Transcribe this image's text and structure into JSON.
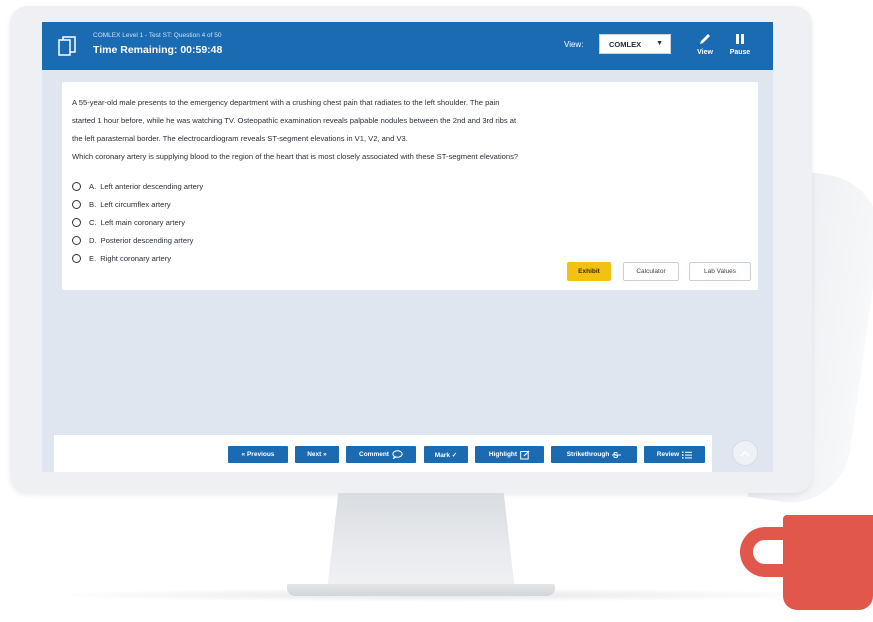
{
  "header": {
    "subtitle": "COMLEX Level 1 - Test ST: Question 4 of 50",
    "timer": "Time Remaining: 00:59:48",
    "view_label": "View:",
    "exam_select_value": "COMLEX",
    "view_button_label": "View",
    "pause_button_label": "Pause"
  },
  "question": {
    "stem": [
      "A 55-year-old male presents to the emergency department with a crushing chest pain that radiates to the left shoulder. The pain",
      "started 1 hour before, while he was watching TV. Osteopathic examination reveals palpable nodules between the 2nd and 3rd ribs at",
      "the left parasternal border. The electrocardiogram reveals ST-segment elevations in V1, V2, and V3."
    ],
    "prompt": "Which coronary artery is supplying blood to the region of the heart that is most closely associated with these ST-segment elevations?",
    "choices": [
      {
        "letter": "A.",
        "text": "Left anterior descending artery"
      },
      {
        "letter": "B.",
        "text": "Left circumflex artery"
      },
      {
        "letter": "C.",
        "text": "Left main coronary artery"
      },
      {
        "letter": "D.",
        "text": "Posterior descending artery"
      },
      {
        "letter": "E.",
        "text": "Right coronary artery"
      }
    ]
  },
  "tools": {
    "exhibit": "Exhibit",
    "calculator": "Calculator",
    "lab_values": "Lab Values"
  },
  "nav": {
    "previous": "« Previous",
    "next": "Next »",
    "comment": "Comment",
    "mark": "Mark ✓",
    "highlight": "Highlight",
    "strikethrough": "Strikethrough",
    "review": "Review"
  },
  "colors": {
    "header_blue": "#1b6bb3",
    "exhibit_yellow": "#f2c112",
    "mug_red": "#e2574c"
  }
}
